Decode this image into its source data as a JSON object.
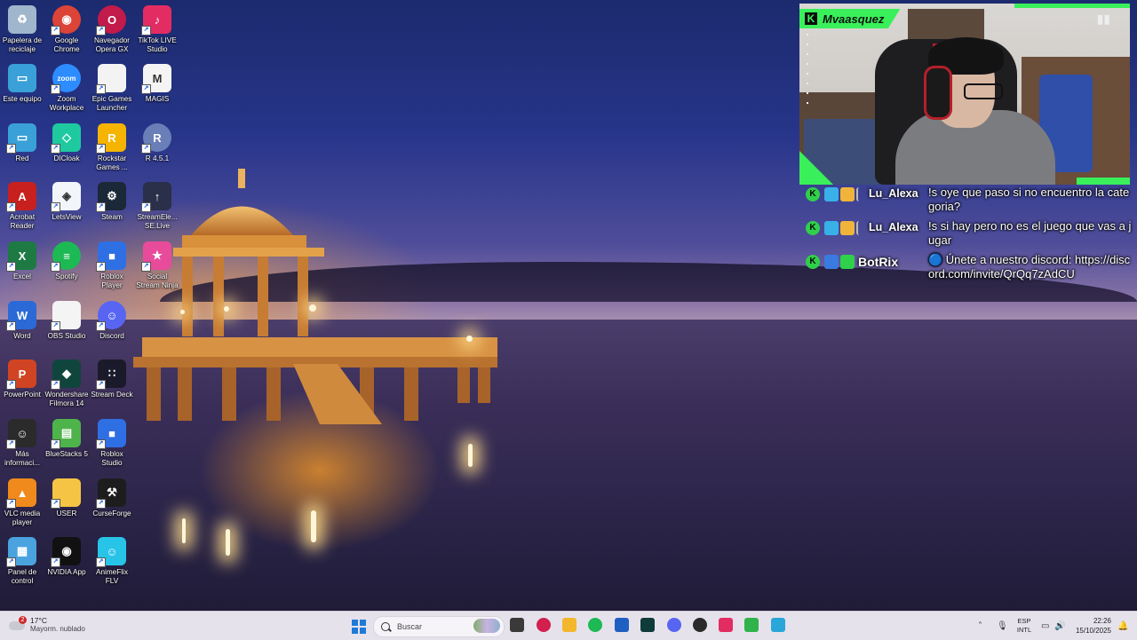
{
  "desktop": {
    "icons": [
      {
        "label": "Papelera de reciclaje",
        "icon": "recycle-bin-icon",
        "color": "#9fb6cc",
        "glyph": "♻",
        "col": 0,
        "row": 0
      },
      {
        "label": "Google Chrome",
        "icon": "chrome-icon",
        "color": "#db4437",
        "glyph": "◉",
        "col": 1,
        "row": 0
      },
      {
        "label": "Navegador Opera GX",
        "icon": "opera-gx-icon",
        "color": "#c21a4a",
        "glyph": "O",
        "col": 2,
        "row": 0
      },
      {
        "label": "TikTok LIVE Studio",
        "icon": "tiktok-live-icon",
        "color": "#e32d62",
        "glyph": "♪",
        "col": 3,
        "row": 0
      },
      {
        "label": "Este equipo",
        "icon": "this-pc-icon",
        "color": "#3aa0d8",
        "glyph": "▭",
        "col": 0,
        "row": 1
      },
      {
        "label": "Zoom Workplace",
        "icon": "zoom-icon",
        "color": "#2d8cff",
        "glyph": "zoom",
        "col": 1,
        "row": 1
      },
      {
        "label": "Epic Games Launcher",
        "icon": "epic-games-icon",
        "color": "#f3f3f3",
        "glyph": "",
        "col": 2,
        "row": 1
      },
      {
        "label": "MAGIS",
        "icon": "magis-icon",
        "color": "#f4f4f4",
        "glyph": "M",
        "col": 3,
        "row": 1
      },
      {
        "label": "Red",
        "icon": "network-icon",
        "color": "#3aa0d8",
        "glyph": "▭",
        "col": 0,
        "row": 2
      },
      {
        "label": "DICloak",
        "icon": "dicloak-icon",
        "color": "#1ec9a0",
        "glyph": "◇",
        "col": 1,
        "row": 2
      },
      {
        "label": "Rockstar Games ...",
        "icon": "rockstar-icon",
        "color": "#f5b400",
        "glyph": "R",
        "col": 2,
        "row": 2
      },
      {
        "label": "R 4.5.1",
        "icon": "r-language-icon",
        "color": "#6a7fb8",
        "glyph": "R",
        "col": 3,
        "row": 2
      },
      {
        "label": "Acrobat Reader",
        "icon": "acrobat-icon",
        "color": "#c8201e",
        "glyph": "A",
        "col": 0,
        "row": 3
      },
      {
        "label": "LetsView",
        "icon": "letsview-icon",
        "color": "#f2f6fb",
        "glyph": "◈",
        "col": 1,
        "row": 3
      },
      {
        "label": "Steam",
        "icon": "steam-icon",
        "color": "#1b2838",
        "glyph": "⚙",
        "col": 2,
        "row": 3
      },
      {
        "label": "StreamEle... SE.Live",
        "icon": "streamelements-icon",
        "color": "#2a2f4a",
        "glyph": "↑",
        "col": 3,
        "row": 3
      },
      {
        "label": "Excel",
        "icon": "excel-icon",
        "color": "#1d7a43",
        "glyph": "X",
        "col": 0,
        "row": 4
      },
      {
        "label": "Spotify",
        "icon": "spotify-icon",
        "color": "#1db954",
        "glyph": "≡",
        "col": 1,
        "row": 4
      },
      {
        "label": "Roblox Player",
        "icon": "roblox-player-icon",
        "color": "#2f6fe4",
        "glyph": "■",
        "col": 2,
        "row": 4
      },
      {
        "label": "Social Stream Ninja",
        "icon": "social-stream-ninja-icon",
        "color": "#e84b9a",
        "glyph": "★",
        "col": 3,
        "row": 4
      },
      {
        "label": "Word",
        "icon": "word-icon",
        "color": "#2b6ad6",
        "glyph": "W",
        "col": 0,
        "row": 5
      },
      {
        "label": "OBS Studio",
        "icon": "obs-studio-icon",
        "color": "#f4f4f4",
        "glyph": "",
        "col": 1,
        "row": 5
      },
      {
        "label": "Discord",
        "icon": "discord-icon",
        "color": "#5865f2",
        "glyph": "☺",
        "col": 2,
        "row": 5
      },
      {
        "label": "PowerPoint",
        "icon": "powerpoint-icon",
        "color": "#d04423",
        "glyph": "P",
        "col": 0,
        "row": 6
      },
      {
        "label": "Wondershare Filmora 14",
        "icon": "filmora-icon",
        "color": "#10453e",
        "glyph": "◆",
        "col": 1,
        "row": 6
      },
      {
        "label": "Stream Deck",
        "icon": "stream-deck-icon",
        "color": "#1a1a2a",
        "glyph": "∷",
        "col": 2,
        "row": 6
      },
      {
        "label": "Más informaci...",
        "icon": "more-info-icon",
        "color": "#2b2b2b",
        "glyph": "☺",
        "col": 0,
        "row": 7
      },
      {
        "label": "BlueStacks 5",
        "icon": "bluestacks-icon",
        "color": "#4fb34b",
        "glyph": "▤",
        "col": 1,
        "row": 7
      },
      {
        "label": "Roblox Studio",
        "icon": "roblox-studio-icon",
        "color": "#2f6fe4",
        "glyph": "■",
        "col": 2,
        "row": 7
      },
      {
        "label": "VLC media player",
        "icon": "vlc-icon",
        "color": "#f08a1c",
        "glyph": "▲",
        "col": 0,
        "row": 8
      },
      {
        "label": "USER",
        "icon": "user-folder-icon",
        "color": "#f6c445",
        "glyph": "",
        "col": 1,
        "row": 8
      },
      {
        "label": "CurseForge",
        "icon": "curseforge-icon",
        "color": "#1d1d1d",
        "glyph": "⚒",
        "col": 2,
        "row": 8
      },
      {
        "label": "Panel de control",
        "icon": "control-panel-icon",
        "color": "#4aa3df",
        "glyph": "▦",
        "col": 0,
        "row": 9
      },
      {
        "label": "NVIDIA App",
        "icon": "nvidia-app-icon",
        "color": "#111",
        "glyph": "◉",
        "col": 1,
        "row": 9
      },
      {
        "label": "AnimeFlix FLV",
        "icon": "animeflix-icon",
        "color": "#27c4e8",
        "glyph": "☺",
        "col": 2,
        "row": 9
      }
    ]
  },
  "stream": {
    "streamer_name": "Mvaasquez",
    "accent": "#39f05a",
    "chat": [
      {
        "user": "Lu_Alexa",
        "text": "!s oye que paso si no encuentro la categoria?"
      },
      {
        "user": "Lu_Alexa",
        "text": "!s si hay pero no es el juego que vas a jugar"
      },
      {
        "user": "BotRix",
        "text": "🔵 Únete a nuestro discord: https://discord.com/invite/QrQq7zAdCU"
      }
    ]
  },
  "taskbar": {
    "weather_temp": "17°C",
    "weather_cond": "Mayorm. nublado",
    "weather_alert": "2",
    "search_placeholder": "Buscar",
    "lang_line1": "ESP",
    "lang_line2": "INTL",
    "time": "22:26",
    "date": "15/10/2025",
    "pinned_apps": [
      {
        "name": "task-view-icon",
        "color": "#3a3a3a"
      },
      {
        "name": "opera-gx-taskbar-icon",
        "color": "#d21f4e"
      },
      {
        "name": "file-explorer-icon",
        "color": "#f2b72c"
      },
      {
        "name": "spotify-taskbar-icon",
        "color": "#1db954"
      },
      {
        "name": "store-icon",
        "color": "#1f5fc2"
      },
      {
        "name": "terminal-icon",
        "color": "#0f3b3a"
      },
      {
        "name": "discord-taskbar-icon",
        "color": "#5865f2"
      },
      {
        "name": "obs-taskbar-icon",
        "color": "#2a2a2a"
      },
      {
        "name": "tiktok-taskbar-icon",
        "color": "#e32d62"
      },
      {
        "name": "social-stream-taskbar-icon",
        "color": "#2fb34a"
      },
      {
        "name": "notepad-icon",
        "color": "#2aa6d8"
      }
    ]
  }
}
